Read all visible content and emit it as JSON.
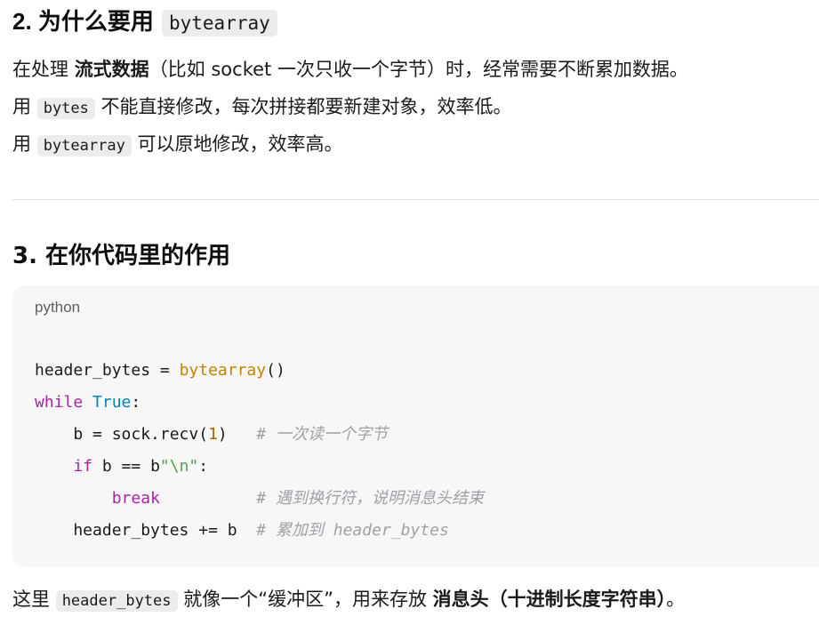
{
  "section2": {
    "heading_prefix": "2. 为什么要用",
    "heading_code": "bytearray",
    "line1_a": "在处理 ",
    "line1_bold": "流式数据",
    "line1_b": "（比如 socket 一次只收一个字节）时，经常需要不断累加数据。",
    "line2_a": "用 ",
    "line2_code": "bytes",
    "line2_b": " 不能直接修改，每次拼接都要新建对象，效率低。",
    "line3_a": "用 ",
    "line3_code": "bytearray",
    "line3_b": " 可以原地修改，效率高。"
  },
  "section3": {
    "heading": "3. 在你代码里的作用",
    "code_lang": "python",
    "code": {
      "l1_var": "header_bytes = ",
      "l1_fn": "bytearray",
      "l1_paren": "()",
      "l2_kw": "while",
      "l2_true": "True",
      "l2_colon": ":",
      "l3_indent": "    b = sock.recv(",
      "l3_num": "1",
      "l3_close": ")   ",
      "l3_comment": "# 一次读一个字节",
      "l4_indent": "    ",
      "l4_kw": "if",
      "l4_mid": " b == b",
      "l4_str": "\"\\n\"",
      "l4_colon": ":",
      "l5_indent": "        ",
      "l5_kw": "break",
      "l5_pad": "          ",
      "l5_comment": "# 遇到换行符，说明消息头结束",
      "l6_code": "    header_bytes += b  ",
      "l6_comment": "# 累加到 header_bytes"
    },
    "footer_a": "这里 ",
    "footer_code": "header_bytes",
    "footer_b": " 就像一个“缓冲区”，用来存放 ",
    "footer_bold": "消息头（十进制长度字符串）",
    "footer_c": "。"
  }
}
